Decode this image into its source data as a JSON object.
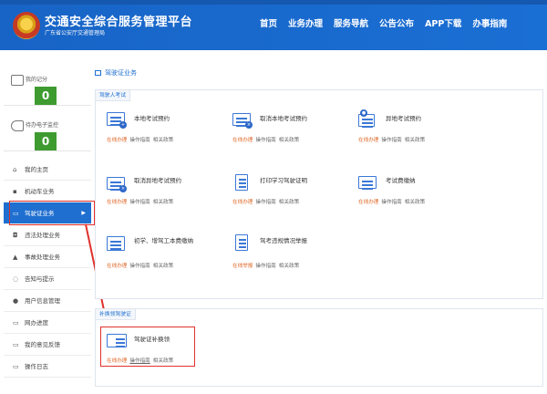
{
  "header": {
    "title": "交通安全综合服务管理平台",
    "subtitle": "广东省公安厅交通管理局",
    "nav": [
      "首页",
      "业务办理",
      "服务导航",
      "公告公布",
      "APP下载",
      "办事指南"
    ]
  },
  "sidebar": {
    "cards": [
      {
        "label": "我的记分",
        "value": "0"
      },
      {
        "label": "待办电子监控",
        "value": "0"
      }
    ],
    "menu": [
      {
        "icon": "⌂",
        "label": "我的主页"
      },
      {
        "icon": "▪",
        "label": "机动车业务"
      },
      {
        "icon": "▭",
        "label": "驾驶证业务"
      },
      {
        "icon": "◘",
        "label": "违法处理业务"
      },
      {
        "icon": "▲",
        "label": "事故处理业务"
      },
      {
        "icon": "◌",
        "label": "告知与提示"
      },
      {
        "icon": "●",
        "label": "用户信息管理"
      },
      {
        "icon": "▭",
        "label": "网办进度"
      },
      {
        "icon": "▭",
        "label": "我的意见反馈"
      },
      {
        "icon": "▭",
        "label": "操作日志"
      }
    ]
  },
  "main": {
    "title": "驾驶证业务",
    "section1": {
      "tag": "驾驶人考试",
      "items": [
        {
          "name": "本地考试预约",
          "links": [
            "在线办理",
            "操作指南",
            "相关政策"
          ]
        },
        {
          "name": "取消本地考试预约",
          "links": [
            "在线办理",
            "操作指南",
            "相关政策"
          ]
        },
        {
          "name": "异地考试预约",
          "links": [
            "在线办理",
            "操作指南",
            "相关政策"
          ]
        },
        {
          "name": "取消异地考试预约",
          "links": [
            "在线办理",
            "操作指南",
            "相关政策"
          ]
        },
        {
          "name": "打印学习驾驶证明",
          "links": [
            "在线办理",
            "操作指南",
            "相关政策"
          ]
        },
        {
          "name": "考试费缴纳",
          "links": [
            "在线办理",
            "操作指南",
            "相关政策"
          ]
        },
        {
          "name": "初学、增驾工本费缴纳",
          "links": [
            "在线办理",
            "操作指南",
            "相关政策"
          ]
        },
        {
          "name": "驾考违规情况举报",
          "links": [
            "在线举报",
            "操作指南",
            "相关政策"
          ]
        }
      ]
    },
    "section2": {
      "tag": "补换领驾驶证",
      "items": [
        {
          "name": "驾驶证补换领",
          "links": [
            "在线办理",
            "操作指南",
            "相关政策"
          ]
        }
      ]
    }
  },
  "colors": {
    "brand": "#1864c6",
    "accent": "#e06a2b",
    "highlight": "#e0312c",
    "count": "#3e9b30"
  }
}
